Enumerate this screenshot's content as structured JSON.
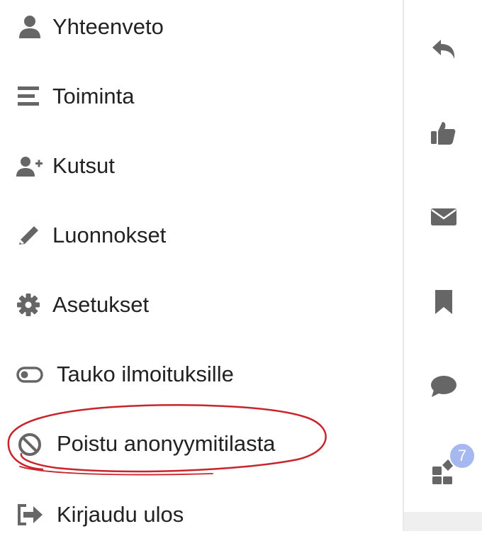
{
  "menu": {
    "items": [
      {
        "label": "Yhteenveto",
        "icon": "user-icon"
      },
      {
        "label": "Toiminta",
        "icon": "activity-lines-icon"
      },
      {
        "label": "Kutsut",
        "icon": "user-plus-icon"
      },
      {
        "label": "Luonnokset",
        "icon": "pencil-icon"
      },
      {
        "label": "Asetukset",
        "icon": "gear-icon"
      },
      {
        "label": "Tauko ilmoituksille",
        "icon": "toggle-icon"
      },
      {
        "label": "Poistu anonyymitilasta",
        "icon": "ban-icon"
      },
      {
        "label": "Kirjaudu ulos",
        "icon": "sign-out-icon"
      }
    ]
  },
  "rail": {
    "buttons": [
      {
        "icon": "reply-icon"
      },
      {
        "icon": "thumbs-up-icon"
      },
      {
        "icon": "envelope-icon"
      },
      {
        "icon": "bookmark-icon"
      },
      {
        "icon": "comment-icon"
      },
      {
        "icon": "grid-shapes-icon",
        "badge": "7"
      }
    ]
  },
  "colors": {
    "icon": "#666666",
    "text": "#222222",
    "badge": "#a6b8ef",
    "annotation": "#c9242b"
  }
}
